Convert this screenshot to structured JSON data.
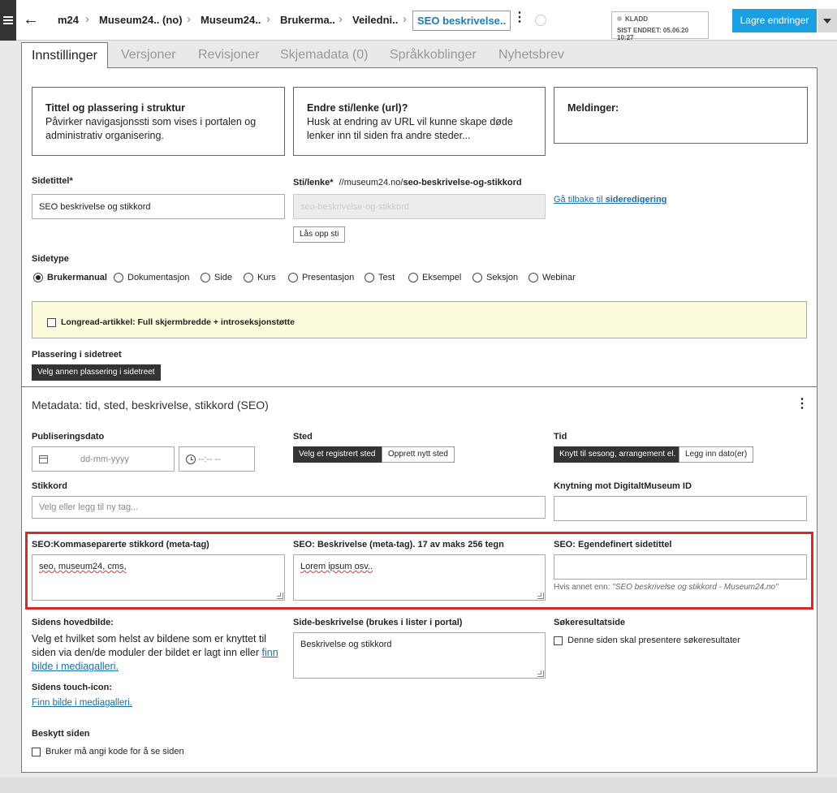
{
  "topbar": {
    "breadcrumbs": [
      "m24",
      "Museum24.. (no)",
      "Museum24..",
      "Brukerma..",
      "Veiledni..",
      "SEO beskrivelse.."
    ],
    "status": {
      "state": "KLADD",
      "last_changed": "SIST ENDRET: 05.06.20 10:27"
    },
    "save_label": "Lagre endringer"
  },
  "tabs": [
    "Innstillinger",
    "Versjoner",
    "Revisjoner",
    "Skjemadata (0)",
    "Språkkoblinger",
    "Nyhetsbrev"
  ],
  "info_boxes": {
    "title_struct": {
      "heading": "Tittel og plassering i struktur",
      "text": "Påvirker navigasjonssti som vises i portalen og administrativ organisering."
    },
    "url": {
      "heading": "Endre sti/lenke (url)?",
      "text": "Husk at endring av URL vil kunne skape døde lenker inn til siden fra andre steder..."
    },
    "messages": {
      "heading": "Meldinger:"
    }
  },
  "page_title": {
    "label": "Sidetittel*",
    "value": "SEO beskrivelse og stikkord"
  },
  "path": {
    "label": "Sti/lenke*",
    "prefix": "//museum24.no/",
    "slug": "seo-beskrivelse-og-stikkord",
    "field_value": "seo-beskrivelse-og-stikkord",
    "unlock_label": "Lås opp sti",
    "back_link_prefix": "Gå tilbake til ",
    "back_link_bold": "sideredigering"
  },
  "page_type": {
    "label": "Sidetype",
    "options": [
      "Brukermanual",
      "Dokumentasjon",
      "Side",
      "Kurs",
      "Presentasjon",
      "Test",
      "Eksempel",
      "Seksjon",
      "Webinar"
    ],
    "selected": "Brukermanual"
  },
  "longread": {
    "label": "Longread-artikkel: Full skjermbredde + introseksjonstøtte"
  },
  "placement": {
    "label": "Plassering i sidetreet",
    "button": "Velg annen plassering i sidetreet"
  },
  "metadata": {
    "title": "Metadata: tid, sted, beskrivelse, stikkord (SEO)",
    "pubdate": {
      "label": "Publiseringsdato",
      "date_placeholder": "dd-mm-yyyy",
      "time_placeholder": "--:-- --"
    },
    "place": {
      "label": "Sted",
      "btn_registered": "Velg et registrert sted",
      "btn_new": "Opprett nytt sted"
    },
    "time": {
      "label": "Tid",
      "btn_link": "Knytt til sesong, arrangement el.",
      "btn_add": "Legg inn dato(er)"
    },
    "tags": {
      "label": "Stikkord",
      "placeholder": "Velg eller legg til ny tag..."
    },
    "dm_id": {
      "label": "Knytning mot DigitaltMuseum ID"
    },
    "seo_keywords": {
      "label": "SEO:Kommaseparerte stikkord (meta-tag)",
      "value": "seo, museum24, cms,"
    },
    "seo_description": {
      "label": "SEO: Beskrivelse (meta-tag). 17 av maks 256 tegn",
      "value": "Lorem ipsum osv.."
    },
    "seo_title": {
      "label": "SEO: Egendefinert sidetittel",
      "hint_prefix": "Hvis annet enn: ",
      "hint_value": "\"SEO beskrivelse og stikkord - Museum24.no\""
    },
    "main_image": {
      "label": "Sidens hovedbilde:",
      "text": "Velg et hvilket som helst av bildene som er knyttet til siden via den/de moduler der bildet er lagt inn eller ",
      "link": "finn bilde i mediagalleri."
    },
    "page_description": {
      "label": "Side-beskrivelse (brukes i lister i portal)",
      "value": "Beskrivelse og stikkord"
    },
    "search_results": {
      "label": "Søkeresultatside",
      "checkbox": "Denne siden skal presentere søkeresultater"
    },
    "touch_icon": {
      "label": "Sidens touch-icon:",
      "link": "Finn bilde i mediagalleri."
    },
    "protect": {
      "label": "Beskytt siden",
      "checkbox": "Bruker må angi kode for å se siden"
    }
  },
  "colors": {
    "accent": "#1a9fe0",
    "link": "#1a6fa0",
    "highlight": "#d42a2a",
    "note_bg": "#fcfcdc"
  }
}
